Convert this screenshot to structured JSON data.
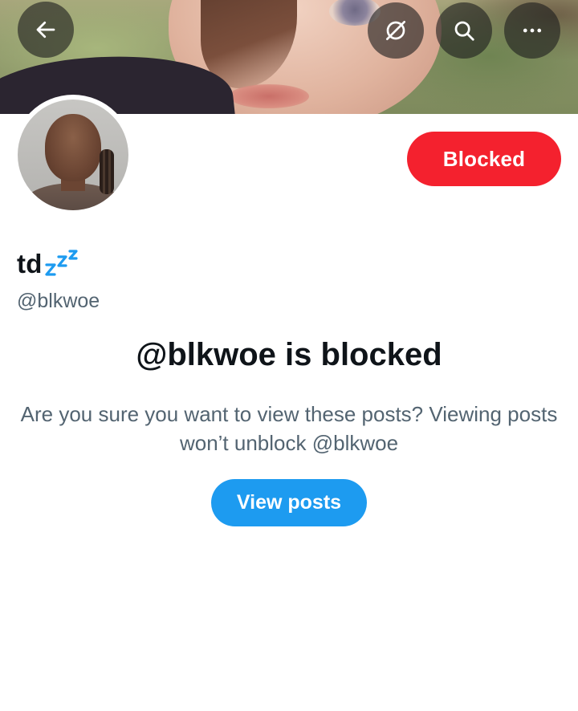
{
  "header": {
    "back_icon": "arrow-left-icon",
    "translate_icon": "translate-off-icon",
    "search_icon": "search-icon",
    "more_icon": "more-horizontal-icon"
  },
  "profile": {
    "display_name": "td",
    "name_emoji": "zzz",
    "handle": "@blkwoe",
    "relationship_button": "Blocked"
  },
  "blocked_notice": {
    "title": "@blkwoe is blocked",
    "text": "Are you sure you want to view these posts? Viewing posts won’t unblock @blkwoe",
    "view_button": "View posts"
  },
  "colors": {
    "blocked_red": "#f4212e",
    "accent_blue": "#1d9bf0",
    "secondary_text": "#536471",
    "primary_text": "#0f1419"
  }
}
